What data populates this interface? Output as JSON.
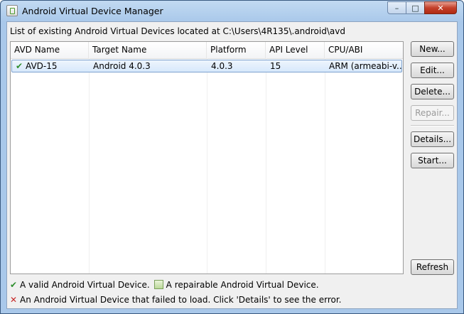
{
  "window": {
    "title": "Android Virtual Device Manager",
    "minimize_glyph": "–",
    "maximize_glyph": "□",
    "close_glyph": "✕"
  },
  "header": {
    "text": "List of existing Android Virtual Devices located at C:\\Users\\4R135\\.android\\avd"
  },
  "table": {
    "columns": [
      "AVD Name",
      "Target Name",
      "Platform",
      "API Level",
      "CPU/ABI"
    ],
    "rows": [
      {
        "name": "AVD-15",
        "target": "Android 4.0.3",
        "platform": "4.0.3",
        "api": "15",
        "cpu": "ARM (armeabi-v...",
        "status_icon": "check-icon"
      }
    ]
  },
  "buttons": {
    "new": "New...",
    "edit": "Edit...",
    "delete": "Delete...",
    "repair": "Repair...",
    "details": "Details...",
    "start": "Start...",
    "refresh": "Refresh"
  },
  "legend": {
    "valid": "A valid Android Virtual Device.",
    "repairable": "A repairable Android Virtual Device.",
    "failed": "An Android Virtual Device that failed to load. Click 'Details' to see the error."
  },
  "colors": {
    "valid": "#2f8f2f",
    "failed": "#c62828",
    "selection": "#d7e8fb"
  }
}
